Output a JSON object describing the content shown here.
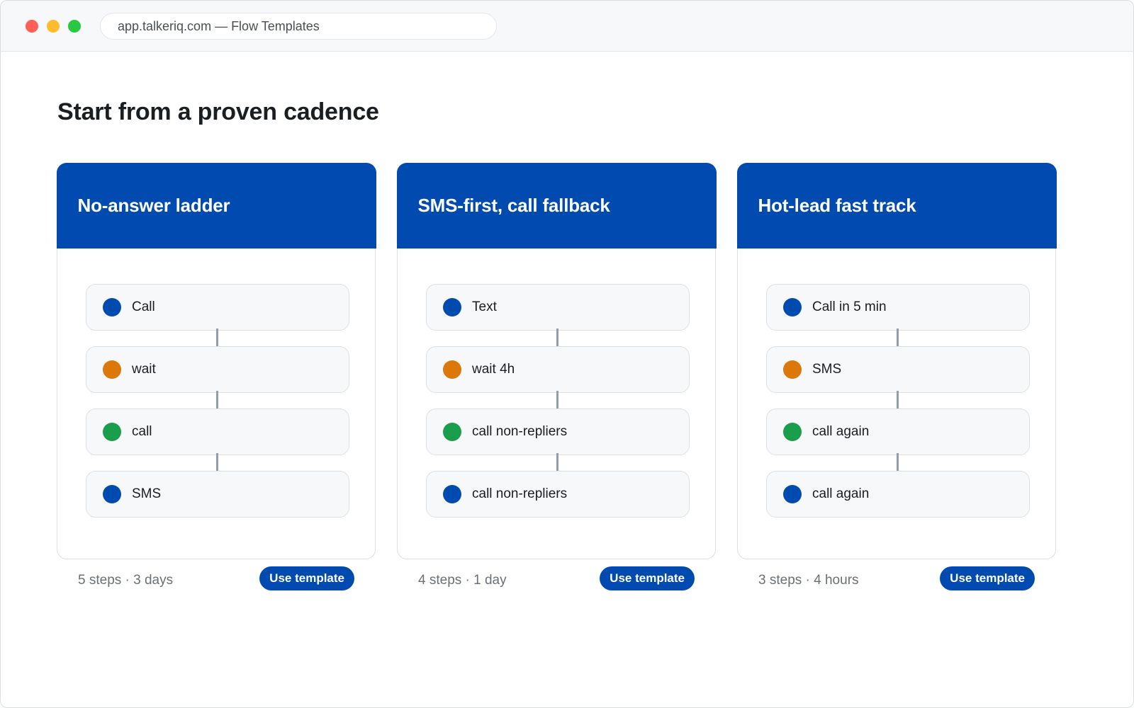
{
  "window": {
    "address": "app.talkeriq.com — Flow Templates"
  },
  "page": {
    "title": "Start from a proven cadence"
  },
  "colors": {
    "brand": "#014bb0",
    "step_blue": "#014bb0",
    "step_orange": "#dc7709",
    "step_green": "#1a9e4b"
  },
  "cards": [
    {
      "title": "No-answer ladder",
      "meta": "5 steps · 3 days",
      "button": "Use template",
      "steps": [
        {
          "label": "Call",
          "color": "#014bb0"
        },
        {
          "label": "wait",
          "color": "#dc7709"
        },
        {
          "label": "call",
          "color": "#1a9e4b"
        },
        {
          "label": "SMS",
          "color": "#014bb0"
        }
      ]
    },
    {
      "title": "SMS-first, call fallback",
      "meta": "4 steps · 1 day",
      "button": "Use template",
      "steps": [
        {
          "label": "Text",
          "color": "#014bb0"
        },
        {
          "label": "wait 4h",
          "color": "#dc7709"
        },
        {
          "label": "call non-repliers",
          "color": "#1a9e4b"
        },
        {
          "label": "call non-repliers",
          "color": "#014bb0"
        }
      ]
    },
    {
      "title": "Hot-lead fast track",
      "meta": "3 steps · 4 hours",
      "button": "Use template",
      "steps": [
        {
          "label": "Call in 5 min",
          "color": "#014bb0"
        },
        {
          "label": "SMS",
          "color": "#dc7709"
        },
        {
          "label": "call again",
          "color": "#1a9e4b"
        },
        {
          "label": "call again",
          "color": "#014bb0"
        }
      ]
    }
  ]
}
